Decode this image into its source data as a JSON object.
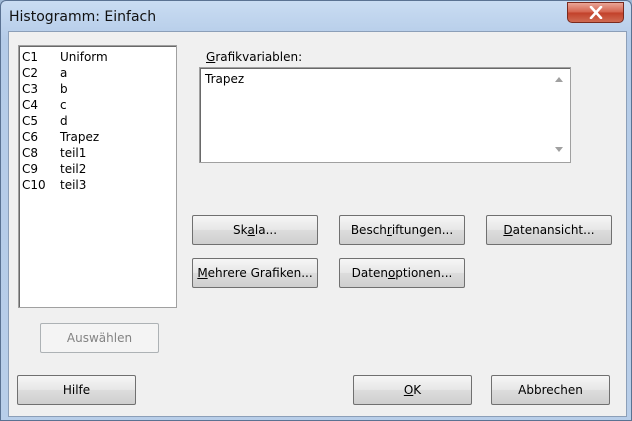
{
  "window": {
    "title": "Histogramm: Einfach"
  },
  "variables_list": [
    {
      "col": "C1",
      "name": "Uniform"
    },
    {
      "col": "C2",
      "name": "a"
    },
    {
      "col": "C3",
      "name": "b"
    },
    {
      "col": "C4",
      "name": "c"
    },
    {
      "col": "C5",
      "name": "d"
    },
    {
      "col": "C6",
      "name": "Trapez"
    },
    {
      "col": "C8",
      "name": "teil1"
    },
    {
      "col": "C9",
      "name": "teil2"
    },
    {
      "col": "C10",
      "name": "teil3"
    }
  ],
  "graph_variables": {
    "label_access_key": "G",
    "label_rest": "rafikvariablen:",
    "value": "Trapez"
  },
  "buttons": {
    "scale": {
      "key": "a",
      "pre": "Sk",
      "post": "la..."
    },
    "labels": {
      "key": "r",
      "pre": "Besch",
      "post": "iftungen..."
    },
    "data_view": {
      "key": "D",
      "pre": "",
      "post": "atenansicht..."
    },
    "multiple_graphs": {
      "key": "M",
      "pre": "",
      "post": "ehrere Grafiken..."
    },
    "data_options": {
      "key": "o",
      "pre": "Daten",
      "post": "ptionen..."
    },
    "select": "Auswählen",
    "help": "Hilfe",
    "ok": {
      "key": "O",
      "pre": "",
      "post": "K"
    },
    "cancel": "Abbrechen"
  },
  "icons": {
    "close": "close-icon",
    "scroll_up": "scroll-up-arrow-icon",
    "scroll_down": "scroll-down-arrow-icon"
  }
}
